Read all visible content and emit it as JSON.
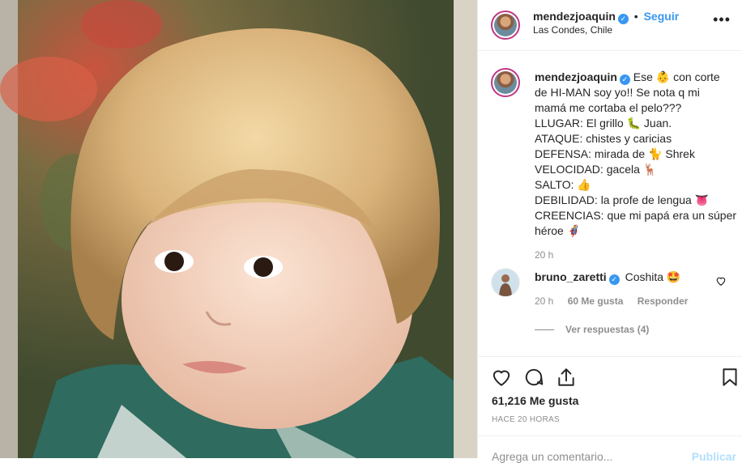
{
  "post": {
    "username": "mendezjoaquin",
    "verified_mark": "✓",
    "follow_label": "Seguir",
    "separator": "•",
    "location": "Las Condes, Chile"
  },
  "caption": {
    "username": "mendezjoaquin",
    "lines": [
      "Ese 👶 con corte",
      "de HI-MAN soy yo!! Se nota q mi",
      "mamá me cortaba el pelo???",
      "LLUGAR: El grillo 🐛 Juan.",
      "ATAQUE: chistes y caricias",
      "DEFENSA: mirada de 🐈 Shrek",
      "VELOCIDAD: gacela 🦌",
      "SALTO: 👍",
      "DEBILIDAD: la profe de lengua 👅",
      "CREENCIAS: que mi papá era un súper",
      "héroe 🦸‍♂️"
    ],
    "time": "20 h"
  },
  "comment": {
    "username": "bruno_zaretti",
    "verified_mark": "✓",
    "text": "Coshita 🤩",
    "time": "20 h",
    "likes": "60 Me gusta",
    "reply_label": "Responder",
    "view_replies": "Ver respuestas (4)"
  },
  "actions": {
    "like_icon": "heart-icon",
    "comment_icon": "comment-icon",
    "share_icon": "share-icon",
    "save_icon": "bookmark-icon"
  },
  "likes_count": "61,216 Me gusta",
  "posted_ago": "HACE 20 HORAS",
  "add_comment": {
    "placeholder": "Agrega un comentario...",
    "publish_label": "Publicar"
  },
  "colors": {
    "link": "#3897f0",
    "muted": "#8e8e8e",
    "text": "#262626",
    "publish_disabled": "#b2dffc"
  }
}
